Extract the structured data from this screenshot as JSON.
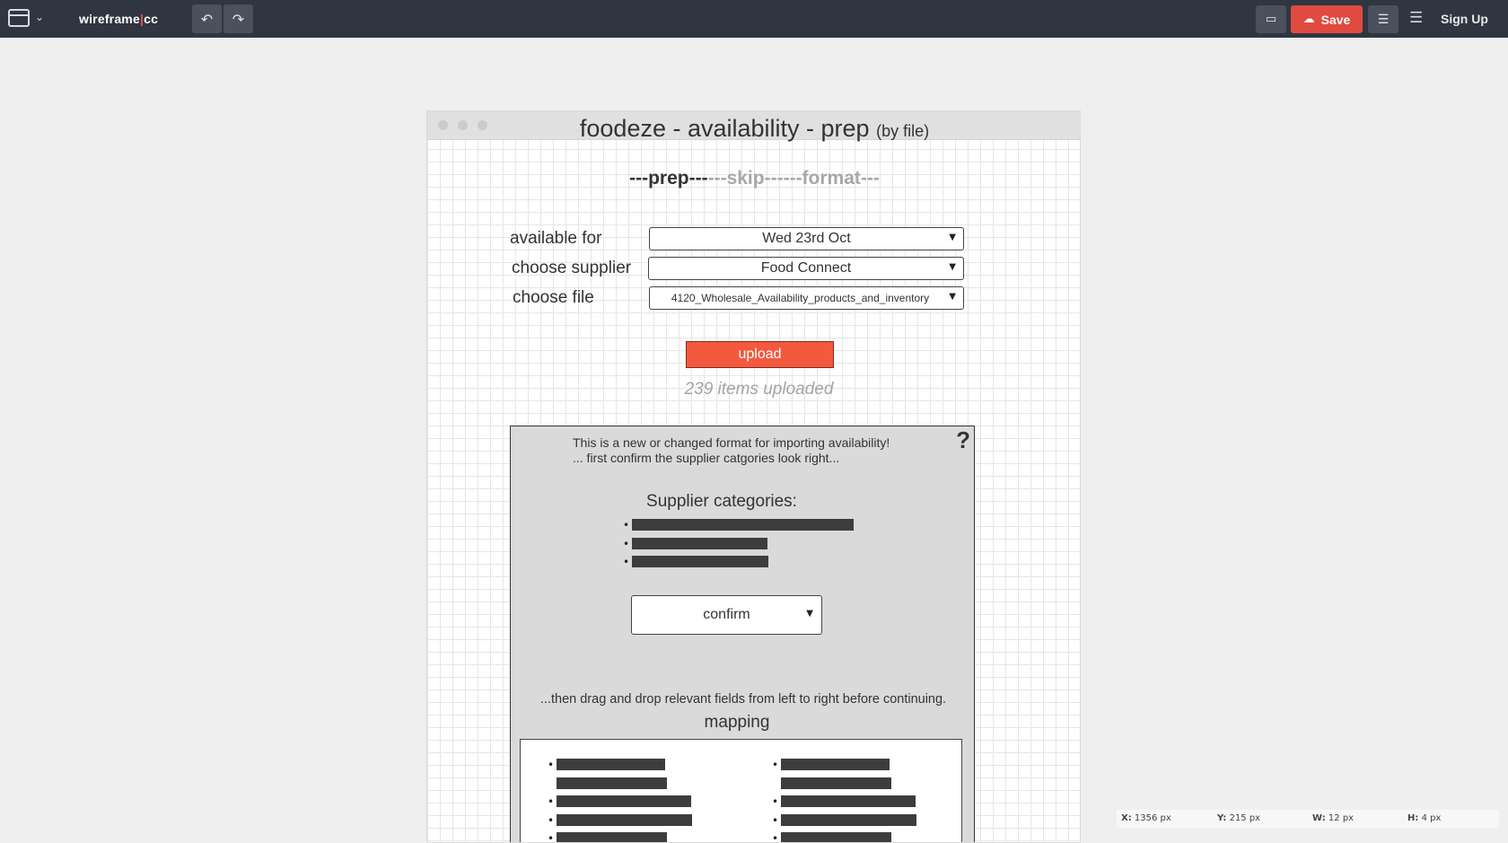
{
  "app": {
    "brand_left": "wireframe",
    "brand_sep": "|",
    "brand_right": "cc",
    "save_label": "Save",
    "signup_label": "Sign Up",
    "icons": [
      "window-icon",
      "chevron-down-icon",
      "undo-icon",
      "redo-icon",
      "comment-icon",
      "cloud-upload-icon",
      "adjust-icon",
      "menu-icon"
    ],
    "accent_color": "#e04a3f",
    "topbar_color": "#2f3642"
  },
  "wireframe": {
    "title": "foodeze - availability - prep",
    "title_sub": "(by file)",
    "steps": {
      "prep": "---prep---",
      "skip": "---skip---",
      "format": "---format---"
    },
    "form": {
      "available_for_label": "available for",
      "available_for_value": "Wed 23rd Oct",
      "supplier_label": "choose supplier",
      "supplier_value": "Food Connect",
      "file_label": "choose file",
      "file_value": "4120_Wholesale_Availability_products_and_inventory"
    },
    "upload_label": "upload",
    "upload_status": "239 items uploaded",
    "panel": {
      "help": "?",
      "notice_line1": "This is a new or changed format for importing availability!",
      "notice_line2": "... first confirm the supplier catgories look right...",
      "categories_title": "Supplier categories:",
      "confirm_label": "confirm",
      "drag_note": "...then drag and drop relevant fields from left to right before continuing.",
      "mapping_title": "mapping"
    }
  },
  "status": {
    "x_label": "X:",
    "x_value": "1356 px",
    "y_label": "Y:",
    "y_value": "215 px",
    "w_label": "W:",
    "w_value": "12 px",
    "h_label": "H:",
    "h_value": "4 px"
  }
}
